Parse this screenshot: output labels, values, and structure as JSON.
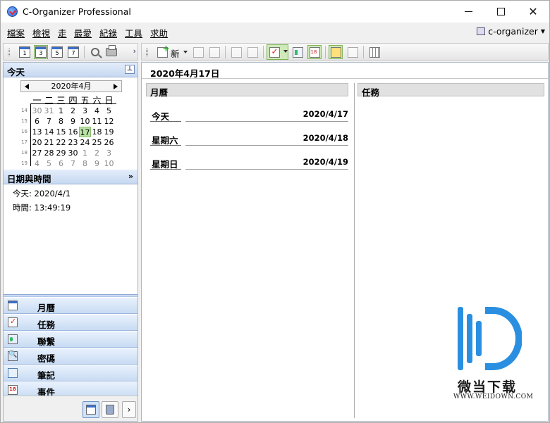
{
  "window": {
    "title": "C-Organizer Professional"
  },
  "menu": {
    "items": [
      "檔案",
      "檢視",
      "走",
      "最愛",
      "紀錄",
      "工具",
      "求助"
    ],
    "profile": "c-organizer"
  },
  "left": {
    "today_header": "今天",
    "calendar": {
      "month_label": "2020年4月",
      "weekdays": [
        "一",
        "二",
        "三",
        "四",
        "五",
        "六",
        "日"
      ],
      "weeks": [
        {
          "num": "14",
          "days": [
            "30",
            "31",
            "1",
            "2",
            "3",
            "4",
            "5"
          ]
        },
        {
          "num": "15",
          "days": [
            "6",
            "7",
            "8",
            "9",
            "10",
            "11",
            "12"
          ]
        },
        {
          "num": "16",
          "days": [
            "13",
            "14",
            "15",
            "16",
            "17",
            "18",
            "19"
          ]
        },
        {
          "num": "17",
          "days": [
            "20",
            "21",
            "22",
            "23",
            "24",
            "25",
            "26"
          ]
        },
        {
          "num": "18",
          "days": [
            "27",
            "28",
            "29",
            "30",
            "1",
            "2",
            "3"
          ]
        },
        {
          "num": "19",
          "days": [
            "4",
            "5",
            "6",
            "7",
            "8",
            "9",
            "10"
          ]
        }
      ],
      "selected_day": "17"
    },
    "datetime_header": "日期與時間",
    "today_text": "今天: 2020/4/1",
    "time_text": "時間: 13:49:19",
    "nav": [
      "月曆",
      "任務",
      "聯繫",
      "密碼",
      "筆記",
      "事件"
    ]
  },
  "toolbar": {
    "new_label": "新"
  },
  "main": {
    "date_header": "2020年4月17日",
    "calendar_col_title": "月曆",
    "task_col_title": "任務",
    "days": [
      {
        "name": "今天",
        "date": "2020/4/17"
      },
      {
        "name": "星期六",
        "date": "2020/4/18"
      },
      {
        "name": "星期日",
        "date": "2020/4/19"
      }
    ]
  },
  "watermark": {
    "brand": "微当下载",
    "url": "WWW.WEIDOWN.COM"
  },
  "colors": {
    "accent_green": "#b9e3a5",
    "nav_blue": "#c8dbf3",
    "watermark_blue": "#2a8fe0"
  }
}
